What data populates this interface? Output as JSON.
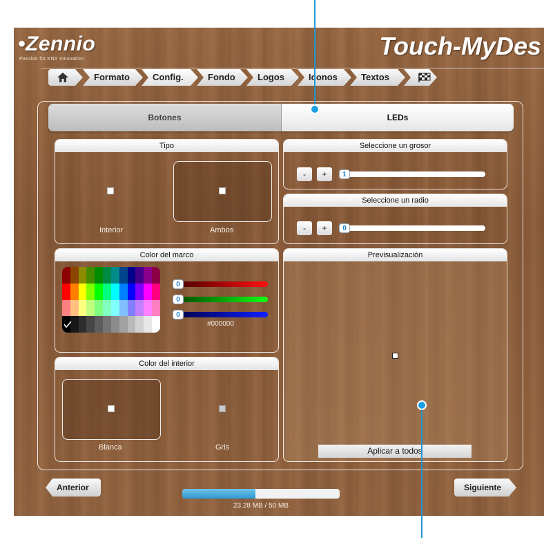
{
  "app": {
    "logo": "•Zennio",
    "tagline": "Passion for KNX Innovation",
    "title": "Touch-MyDes"
  },
  "breadcrumb": [
    "Formato",
    "Config.",
    "Fondo",
    "Logos",
    "Iconos",
    "Textos"
  ],
  "tabs": {
    "botones": "Botones",
    "leds": "LEDs",
    "active": "LEDs"
  },
  "tipo": {
    "title": "Tipo",
    "interior": "Interior",
    "ambos": "Ambos",
    "selected": "Ambos"
  },
  "grosor": {
    "title": "Seleccione un grosor",
    "minus": "-",
    "plus": "+",
    "value": "1"
  },
  "radio": {
    "title": "Seleccione un radio",
    "minus": "-",
    "plus": "+",
    "value": "0"
  },
  "color_marco": {
    "title": "Color del marco",
    "r": "0",
    "g": "0",
    "b": "0",
    "hex": "#000000",
    "palette": [
      [
        "#8b0000",
        "#8b4500",
        "#8b8b00",
        "#458b00",
        "#008b00",
        "#008b45",
        "#008b8b",
        "#00458b",
        "#00008b",
        "#45008b",
        "#8b008b",
        "#8b0045"
      ],
      [
        "#ff0000",
        "#ff8000",
        "#ffff00",
        "#80ff00",
        "#00ff00",
        "#00ff80",
        "#00ffff",
        "#0080ff",
        "#0000ff",
        "#8000ff",
        "#ff00ff",
        "#ff0080"
      ],
      [
        "#ff8080",
        "#ffc080",
        "#ffff80",
        "#c0ff80",
        "#80ff80",
        "#80ffc0",
        "#80ffff",
        "#80c0ff",
        "#8080ff",
        "#c080ff",
        "#ff80ff",
        "#ff80c0"
      ],
      [
        "#000000",
        "#171717",
        "#2e2e2e",
        "#464646",
        "#5d5d5d",
        "#747474",
        "#8b8b8b",
        "#a2a2a2",
        "#b9b9b9",
        "#d1d1d1",
        "#e8e8e8",
        "#ffffff"
      ]
    ]
  },
  "color_interior": {
    "title": "Color del interior",
    "blanca": "Blanca",
    "gris": "Gris",
    "selected": "Blanca"
  },
  "preview": {
    "title": "Previsualización",
    "apply": "Aplicar a todos"
  },
  "nav": {
    "prev": "Anterior",
    "next": "Siguiente"
  },
  "storage": {
    "text": "23.28 MB / 50 MB",
    "fraction": 0.4656
  },
  "colors": {
    "accent": "#2196d8",
    "wood": "#8a5c3a"
  }
}
